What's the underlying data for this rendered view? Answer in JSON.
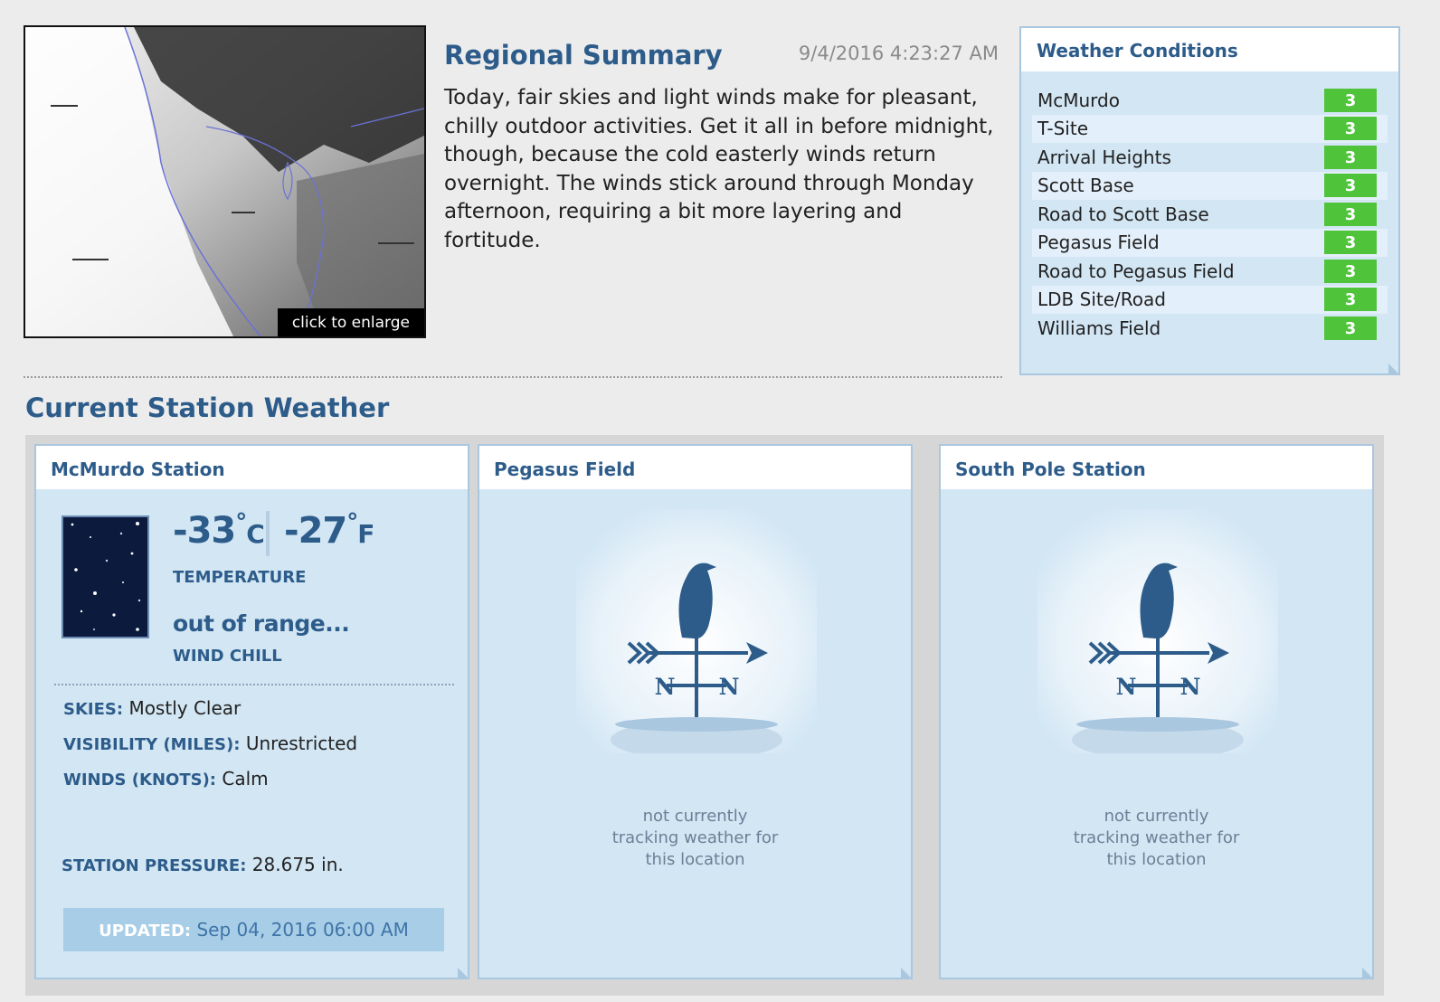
{
  "map": {
    "enlarge_label": "click to enlarge"
  },
  "summary": {
    "title": "Regional Summary",
    "timestamp": "9/4/2016 4:23:27 AM",
    "text": "Today, fair skies and light winds make for pleasant, chilly outdoor activities. Get it all in before midnight, though, because the cold easterly winds return overnight. The winds stick around through Monday afternoon, requiring a bit more layering and fortitude."
  },
  "conditions": {
    "title": "Weather Conditions",
    "badge_color": "#4fc43a",
    "rows": [
      {
        "name": "McMurdo",
        "value": "3"
      },
      {
        "name": "T-Site",
        "value": "3"
      },
      {
        "name": "Arrival Heights",
        "value": "3"
      },
      {
        "name": "Scott Base",
        "value": "3"
      },
      {
        "name": "Road to Scott Base",
        "value": "3"
      },
      {
        "name": "Pegasus Field",
        "value": "3"
      },
      {
        "name": "Road to Pegasus Field",
        "value": "3"
      },
      {
        "name": "LDB Site/Road",
        "value": "3"
      },
      {
        "name": "Williams Field",
        "value": "3"
      }
    ]
  },
  "current": {
    "title": "Current Station Weather",
    "mcmurdo": {
      "name": "McMurdo Station",
      "icon": "clear-night-icon",
      "temp_c": "-33",
      "temp_f": "-27",
      "unit_c": "C",
      "unit_f": "F",
      "degree": "°",
      "temperature_label": "TEMPERATURE",
      "wind_chill_value": "out of range...",
      "wind_chill_label": "WIND CHILL",
      "skies_label": "SKIES:",
      "skies_value": "Mostly Clear",
      "visibility_label": "VISIBILITY (MILES):",
      "visibility_value": "Unrestricted",
      "winds_label": "WINDS (KNOTS):",
      "winds_value": "Calm",
      "pressure_label": "STATION PRESSURE:",
      "pressure_value": "28.675 in.",
      "updated_label": "UPDATED:",
      "updated_value": "Sep 04, 2016 06:00 AM"
    },
    "pegasus": {
      "name": "Pegasus Field",
      "line1": "not currently",
      "line2": "tracking weather for",
      "line3": "this location"
    },
    "southpole": {
      "name": "South Pole Station",
      "line1": "not currently",
      "line2": "tracking weather for",
      "line3": "this location"
    }
  }
}
